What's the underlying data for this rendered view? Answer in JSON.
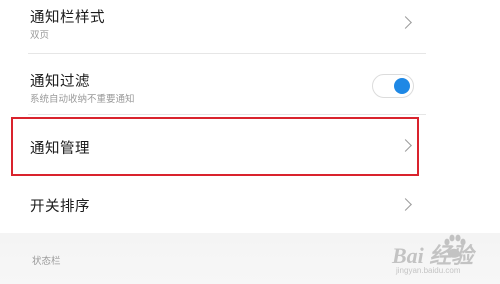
{
  "settings": {
    "items": [
      {
        "title": "通知栏样式",
        "subtitle": "双页"
      },
      {
        "title": "通知过滤",
        "subtitle": "系统自动收纳不重要通知",
        "toggle_on": true
      },
      {
        "title": "通知管理"
      },
      {
        "title": "开关排序"
      }
    ],
    "section_label": "状态栏"
  },
  "colors": {
    "toggle_accent": "#1e88e5",
    "highlight_border": "#d9232d"
  },
  "watermark": {
    "brand": "Bai 经验",
    "url": "jingyan.baidu.com"
  }
}
